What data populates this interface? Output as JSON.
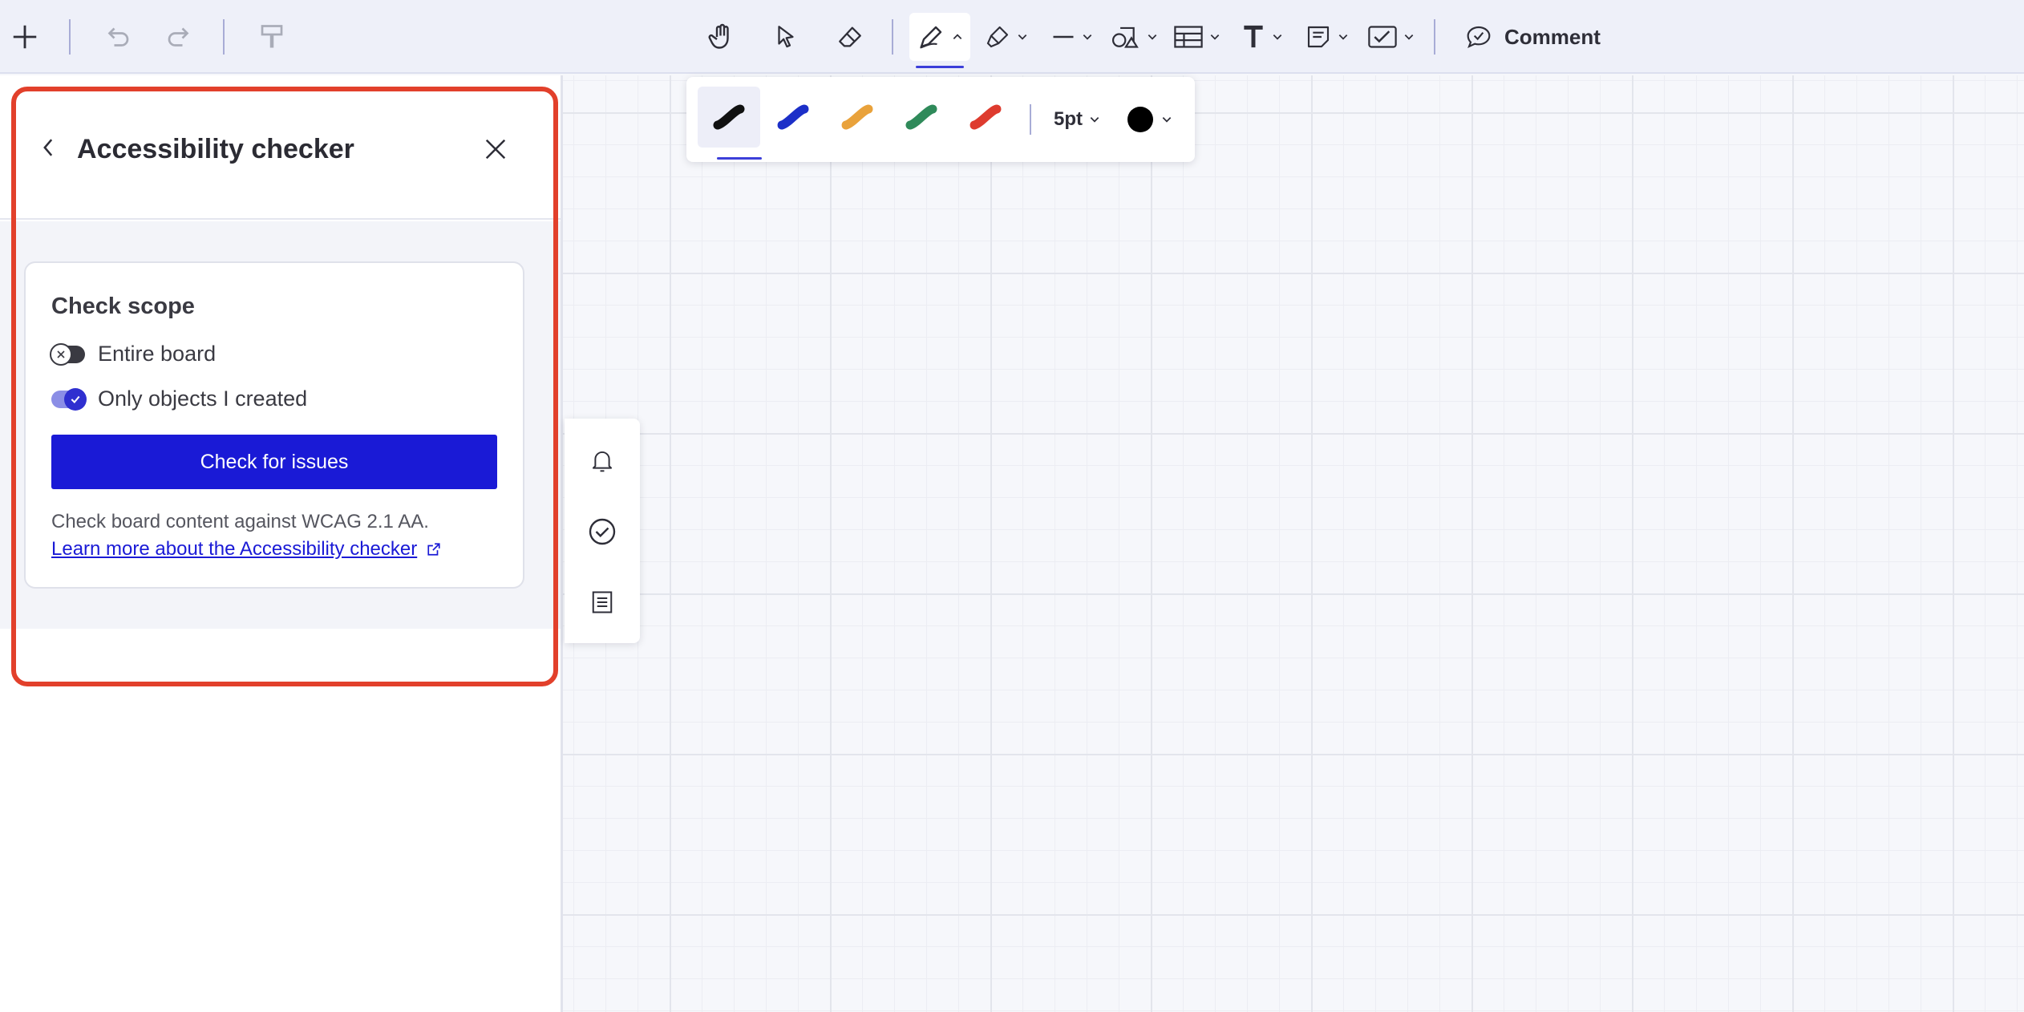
{
  "toolbar": {
    "add": "add-icon",
    "undo": "undo-icon",
    "redo": "redo-icon",
    "format_painter": "format-painter-icon",
    "tools": [
      "hand-icon",
      "select-icon",
      "eraser-icon",
      "pen-icon",
      "highlighter-icon",
      "line-icon",
      "shapes-icon",
      "table-icon",
      "text-icon",
      "sticky-note-icon",
      "checklist-icon"
    ],
    "active_tool": "pen",
    "comment_label": "Comment"
  },
  "pen_bar": {
    "swatches": [
      {
        "name": "black",
        "color": "#111111"
      },
      {
        "name": "blue",
        "color": "#1c2fc8"
      },
      {
        "name": "orange",
        "color": "#e9a23b"
      },
      {
        "name": "green",
        "color": "#2f8a5a"
      },
      {
        "name": "red",
        "color": "#de3b2e"
      }
    ],
    "selected_swatch": "black",
    "size_label": "5pt",
    "color": "#000000"
  },
  "panel": {
    "title": "Accessibility checker",
    "card": {
      "title": "Check scope",
      "options": [
        {
          "label": "Entire board",
          "on": false
        },
        {
          "label": "Only objects I created",
          "on": true
        }
      ],
      "button_label": "Check for issues",
      "description": "Check board content against WCAG 2.1 AA.",
      "link_label": "Learn more about the Accessibility checker"
    }
  },
  "side_tools": [
    "bell-icon",
    "check-circle-icon",
    "list-icon"
  ],
  "colors": {
    "accent": "#1a1ad6",
    "highlight": "#e2402b"
  }
}
